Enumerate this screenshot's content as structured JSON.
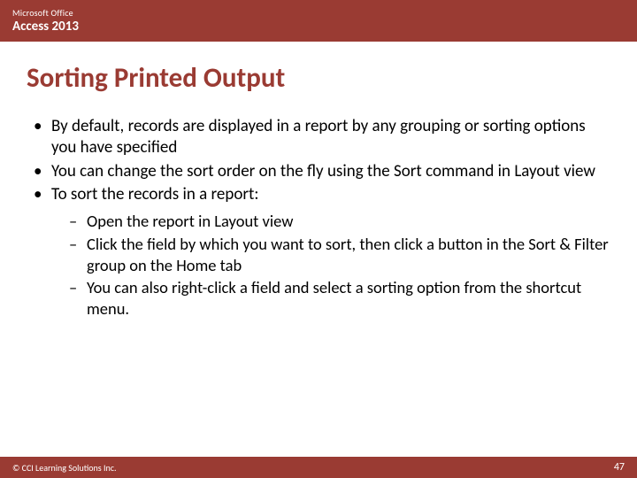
{
  "header": {
    "superscript": "Microsoft Office",
    "title": "Access 2013"
  },
  "slide_title": "Sorting Printed Output",
  "bullets": [
    "By default, records are displayed in a report by any grouping or sorting options you have specified",
    "You can change the sort order on the fly using the Sort command in Layout view",
    "To sort the records in a report:"
  ],
  "sub_bullets": [
    "Open the report in Layout view",
    "Click the field by which you want to sort, then click a button in the Sort & Filter group on the Home tab",
    "You can also right-click a field and select a sorting option from the shortcut menu."
  ],
  "footer": {
    "copyright": "© CCI Learning Solutions Inc.",
    "page": "47"
  }
}
